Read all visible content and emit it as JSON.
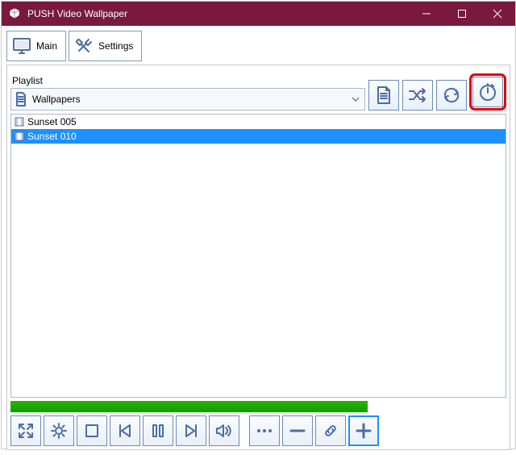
{
  "titlebar": {
    "title": "PUSH Video Wallpaper"
  },
  "tabs": {
    "main": "Main",
    "settings": "Settings"
  },
  "playlist": {
    "label": "Playlist",
    "selected": "Wallpapers",
    "items": [
      "Sunset 005",
      "Sunset 010"
    ],
    "selected_index": 1
  }
}
